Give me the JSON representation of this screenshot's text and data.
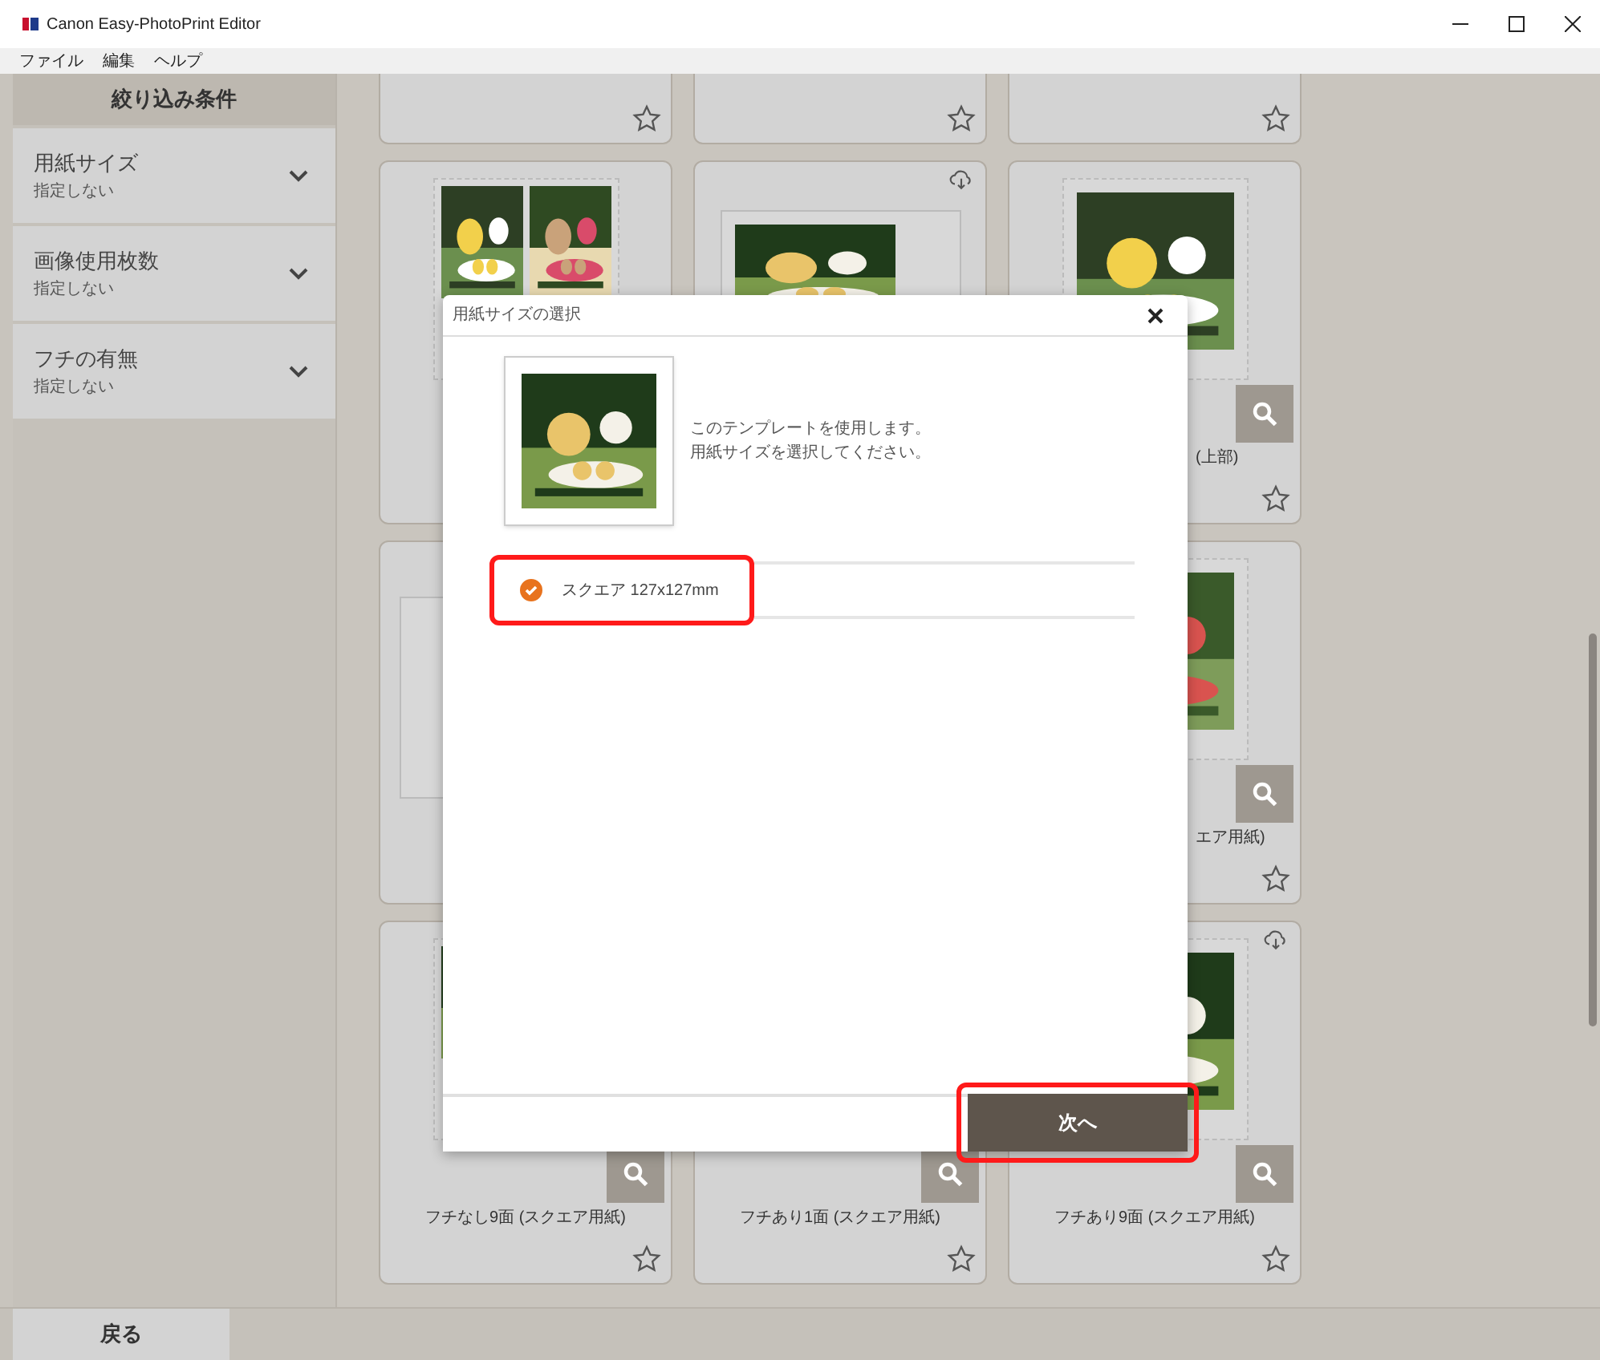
{
  "window": {
    "title": "Canon Easy-PhotoPrint Editor"
  },
  "menu": [
    "ファイル",
    "編集",
    "ヘルプ"
  ],
  "sidebar": {
    "title": "絞り込み条件",
    "filters": [
      {
        "label": "用紙サイズ",
        "value": "指定しない",
        "expanded": false
      },
      {
        "label": "画像使用枚数",
        "value": "指定しない",
        "expanded": false
      },
      {
        "label": "フチの有無",
        "value": "指定しない",
        "expanded": false
      }
    ]
  },
  "cards": [
    {
      "kind": "template",
      "favorite": false
    },
    {
      "kind": "template",
      "favorite": false
    },
    {
      "kind": "template",
      "favorite": false
    },
    {
      "kind": "template"
    },
    {
      "kind": "template",
      "cloud": true
    },
    {
      "kind": "template",
      "favorite": false,
      "zoom_button": true,
      "label": "(上部)"
    },
    {
      "kind": "template"
    },
    {
      "kind": "template",
      "favorite": false,
      "zoom_button": true,
      "label": "エア用紙)"
    },
    {
      "kind": "template",
      "favorite": false,
      "zoom_button": true,
      "label": "フチなし9面 (スクエア用紙)"
    },
    {
      "kind": "template",
      "favorite": false,
      "zoom_button": true,
      "label": "フチあり1面 (スクエア用紙)"
    },
    {
      "kind": "template",
      "favorite": false,
      "cloud": true,
      "zoom_button": true,
      "label": "フチあり9面 (スクエア用紙)"
    }
  ],
  "dialog": {
    "title": "用紙サイズの選択",
    "message": [
      "このテンプレートを使用します。",
      "用紙サイズを選択してください。"
    ],
    "options": [
      {
        "label": "スクエア 127x127mm",
        "selected": true,
        "highlighted": true
      }
    ],
    "button": {
      "label": "次へ",
      "highlighted": true
    }
  },
  "back_button": "戻る"
}
